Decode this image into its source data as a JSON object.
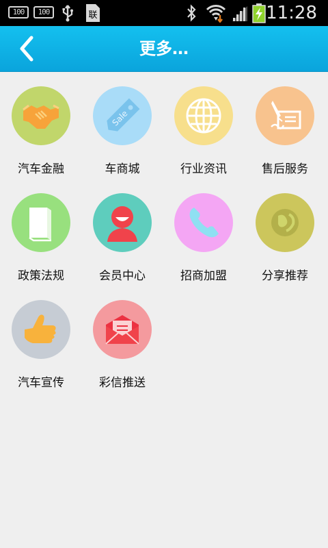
{
  "status_bar": {
    "badge_left_1": "100",
    "badge_left_2": "100",
    "sim_icon_label": "联",
    "time": "11:28",
    "icons": [
      "battery-100-icon",
      "battery-100-icon",
      "usb-icon",
      "sim-icon",
      "bluetooth-icon",
      "wifi-icon",
      "signal-icon",
      "battery-charging-icon"
    ]
  },
  "header": {
    "title": "更多…",
    "back_icon": "back-arrow-icon",
    "background": "#0aaee2"
  },
  "grid": {
    "items": [
      {
        "label": "汽车金融",
        "icon": "handshake-icon",
        "color": "#c1d66b"
      },
      {
        "label": "车商城",
        "icon": "sale-tag-icon",
        "color": "#a9dcf8"
      },
      {
        "label": "行业资讯",
        "icon": "globe-icon",
        "color": "#f7df8c"
      },
      {
        "label": "售后服务",
        "icon": "pen-signature-icon",
        "color": "#f8c38e"
      },
      {
        "label": "政策法规",
        "icon": "book-icon",
        "color": "#98e07e"
      },
      {
        "label": "会员中心",
        "icon": "member-person-icon",
        "color": "#5ecdbd"
      },
      {
        "label": "招商加盟",
        "icon": "phone-icon",
        "color": "#f4a6f4"
      },
      {
        "label": "分享推荐",
        "icon": "share-globe-icon",
        "color": "#ccc65c"
      },
      {
        "label": "汽车宣传",
        "icon": "thumbs-up-icon",
        "color": "#c6ccd4"
      },
      {
        "label": "彩信推送",
        "icon": "mms-envelope-icon",
        "color": "#f49a9e"
      }
    ]
  }
}
